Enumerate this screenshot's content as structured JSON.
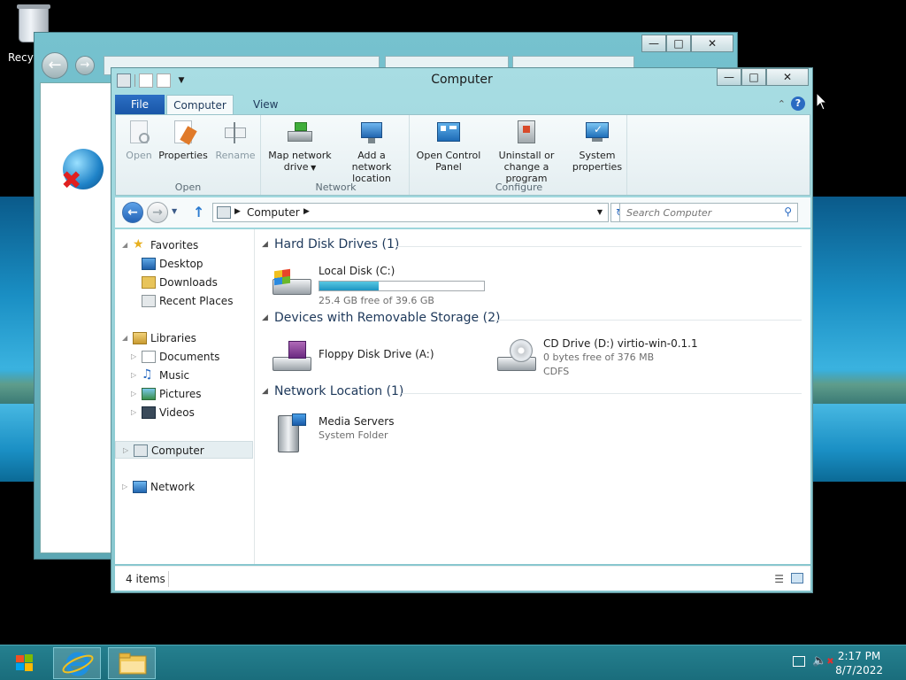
{
  "desktop": {
    "recycle_bin_label": "Recyc"
  },
  "explorer": {
    "title": "Computer",
    "ribbon_tabs": {
      "file": "File",
      "computer": "Computer",
      "view": "View"
    },
    "ribbon_groups": {
      "open": {
        "label": "Open",
        "buttons": {
          "open": "Open",
          "properties": "Properties",
          "rename": "Rename"
        }
      },
      "network": {
        "label": "Network",
        "buttons": {
          "map_drive_line1": "Map network",
          "map_drive_line2": "drive",
          "add_location_line1": "Add a network",
          "add_location_line2": "location"
        }
      },
      "configure": {
        "label": "Configure",
        "buttons": {
          "control_panel_line1": "Open Control",
          "control_panel_line2": "Panel",
          "uninstall_line1": "Uninstall or",
          "uninstall_line2": "change a program",
          "system_line1": "System",
          "system_line2": "properties"
        }
      }
    },
    "address": {
      "crumb": "Computer",
      "search_placeholder": "Search Computer"
    },
    "nav_pane": {
      "favorites": "Favorites",
      "desktop": "Desktop",
      "downloads": "Downloads",
      "recent_places": "Recent Places",
      "libraries": "Libraries",
      "documents": "Documents",
      "music": "Music",
      "pictures": "Pictures",
      "videos": "Videos",
      "computer": "Computer",
      "network": "Network"
    },
    "groups": {
      "hdd": "Hard Disk Drives (1)",
      "removable": "Devices with Removable Storage (2)",
      "network": "Network Location (1)"
    },
    "drives": {
      "local_disk": {
        "name": "Local Disk (C:)",
        "free": "25.4 GB free of 39.6 GB",
        "used_fraction": 0.36
      },
      "floppy": {
        "name": "Floppy Disk Drive (A:)"
      },
      "cd": {
        "name": "CD Drive (D:) virtio-win-0.1.1",
        "free": "0 bytes free of 376 MB",
        "fs": "CDFS"
      },
      "media": {
        "name": "Media Servers",
        "type": "System Folder"
      }
    },
    "status": {
      "items": "4 items"
    }
  },
  "taskbar": {
    "time": "2:17 PM",
    "date": "8/7/2022"
  },
  "colors": {
    "accent_blue": "#2b6fc4",
    "window_frame": "#a8dde3",
    "taskbar": "#25808f",
    "group_heading": "#1e395b"
  }
}
